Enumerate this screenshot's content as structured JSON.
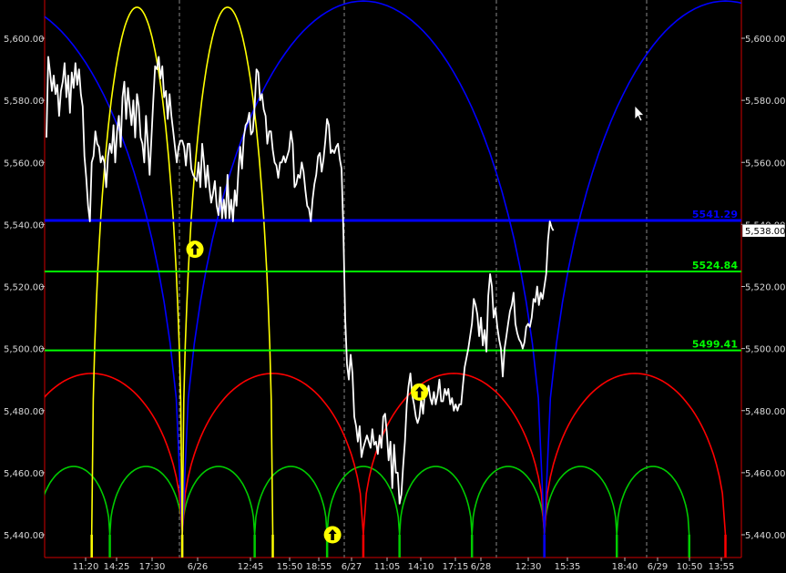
{
  "chart_data": {
    "type": "line",
    "title": "",
    "xlabel": "",
    "ylabel": "",
    "ylim": [
      5430,
      5612
    ],
    "y_ticks": [
      5440,
      5460,
      5480,
      5500,
      5520,
      5540,
      5560,
      5580,
      5600
    ],
    "y_tick_labels": [
      "5,440.00",
      "5,460.00",
      "5,480.00",
      "5,500.00",
      "5,520.00",
      "5,540.00",
      "5,560.00",
      "5,580.00",
      "5,600.00"
    ],
    "x_tick_labels": [
      "11:20",
      "14:25",
      "17:30",
      "6/26",
      "12:45",
      "15:50",
      "18:55",
      "6/27",
      "11:05",
      "14:10",
      "17:15",
      "6/28",
      "12:30",
      "15:35",
      "18:40",
      "6/29",
      "10:50",
      "13:55"
    ],
    "day_separators": [
      "6/26",
      "6/27",
      "6/28",
      "6/29"
    ],
    "grid": false,
    "last_price_label": "5,538.00",
    "last_price": 5538.0,
    "series": [
      {
        "role": "price",
        "color": "#ffffff",
        "index": [
          0,
          1,
          2,
          3,
          4,
          5,
          6,
          7,
          8,
          9,
          10,
          11,
          12,
          13,
          14,
          15,
          16,
          17,
          18,
          19,
          20,
          21,
          22,
          23,
          24,
          25,
          26,
          27,
          28,
          29,
          30,
          31,
          32,
          33,
          34,
          35,
          36,
          37,
          38,
          39,
          40,
          41,
          42,
          43,
          44,
          45,
          46,
          47,
          48,
          49,
          50,
          51,
          52,
          53,
          54,
          55,
          56,
          57,
          58,
          59,
          60,
          61,
          62,
          63,
          64,
          65,
          66,
          67,
          68,
          69,
          70,
          71,
          72,
          73,
          74,
          75,
          76,
          77,
          78,
          79,
          80,
          81,
          82,
          83,
          84,
          85,
          86,
          87,
          88,
          89,
          90,
          91,
          92,
          93,
          94,
          95,
          96,
          97,
          98,
          99,
          100,
          101,
          102,
          103,
          104,
          105,
          106,
          107,
          108,
          109,
          110,
          111,
          112,
          113,
          114,
          115,
          116,
          117,
          118,
          119,
          120,
          121,
          122,
          123,
          124,
          125,
          126,
          127,
          128,
          129,
          130,
          131,
          132,
          133,
          134,
          135,
          136,
          137,
          138,
          139,
          140,
          141,
          142,
          143,
          144,
          145,
          146,
          147,
          148,
          149,
          150,
          151,
          152,
          153,
          154,
          155,
          156,
          157,
          158,
          159,
          160,
          161,
          162,
          163,
          164,
          165,
          166,
          167,
          168,
          169,
          170,
          171,
          172,
          173,
          174,
          175,
          176,
          177,
          178,
          179,
          180,
          181,
          182,
          183,
          184,
          185,
          186,
          187,
          188,
          189,
          190,
          191,
          192,
          193,
          194,
          195,
          196,
          197,
          198,
          199,
          200,
          201,
          202,
          203,
          204,
          205,
          206,
          207,
          208,
          209,
          210,
          211,
          212,
          213,
          214,
          215,
          216,
          217,
          218,
          219,
          220,
          221,
          222,
          223,
          224,
          225,
          226,
          227,
          228,
          229,
          230,
          231,
          232,
          233,
          234,
          235,
          236,
          237,
          238,
          239,
          240,
          241,
          242,
          243,
          244,
          245,
          246,
          247,
          248,
          249,
          250,
          251,
          252,
          253,
          254,
          255,
          256,
          257,
          258,
          259,
          260,
          261,
          262,
          263,
          264,
          265,
          266,
          267,
          268,
          269,
          270,
          271,
          272,
          273,
          274,
          275,
          276,
          277,
          278,
          279,
          280,
          281,
          282,
          283,
          284,
          285,
          286,
          287,
          288,
          289,
          290,
          291,
          292,
          293,
          294,
          295,
          296,
          297,
          298,
          299,
          300,
          301,
          302,
          303,
          304,
          305,
          306,
          307,
          308,
          309,
          310,
          311,
          312,
          313,
          314,
          315,
          316,
          317,
          318,
          319,
          320,
          321,
          322,
          323,
          324,
          325,
          326,
          327,
          328,
          329,
          330,
          331,
          332,
          333,
          334
        ],
        "values": [
          5568,
          5594,
          5589,
          5583,
          5588,
          5582,
          5585,
          5575,
          5583,
          5586,
          5592,
          5581,
          5588,
          5576,
          5589,
          5584,
          5592,
          5585,
          5590,
          5582,
          5578,
          5562,
          5555,
          5546,
          5541,
          5560,
          5562,
          5570,
          5566,
          5565,
          5560,
          5562,
          5560,
          5552,
          5562,
          5566,
          5563,
          5572,
          5560,
          5570,
          5575,
          5565,
          5581,
          5586,
          5574,
          5584,
          5578,
          5572,
          5580,
          5568,
          5582,
          5578,
          5568,
          5566,
          5560,
          5575,
          5566,
          5556,
          5568,
          5580,
          5591,
          5590,
          5594,
          5587,
          5591,
          5581,
          5583,
          5574,
          5582,
          5575,
          5570,
          5565,
          5560,
          5565,
          5567,
          5567,
          5565,
          5559,
          5566,
          5566,
          5558,
          5556,
          5555,
          5554,
          5560,
          5552,
          5566,
          5560,
          5552,
          5559,
          5552,
          5547,
          5550,
          5554,
          5546,
          5543,
          5552,
          5542,
          5548,
          5542,
          5556,
          5542,
          5548,
          5541,
          5551,
          5546,
          5557,
          5565,
          5558,
          5568,
          5572,
          5573,
          5576,
          5569,
          5570,
          5578,
          5590,
          5589,
          5580,
          5582,
          5577,
          5575,
          5566,
          5570,
          5570,
          5564,
          5560,
          5559,
          5555,
          5560,
          5560,
          5562,
          5560,
          5562,
          5564,
          5570,
          5566,
          5552,
          5553,
          5556,
          5555,
          5560,
          5557,
          5551,
          5546,
          5545,
          5541,
          5548,
          5553,
          5556,
          5562,
          5563,
          5557,
          5561,
          5567,
          5574,
          5572,
          5563,
          5564,
          5563,
          5565,
          5566,
          5561,
          5558,
          5538,
          5510,
          5495,
          5490,
          5498,
          5492,
          5478,
          5475,
          5470,
          5475,
          5465,
          5468,
          5470,
          5472,
          5470,
          5468,
          5474,
          5469,
          5470,
          5466,
          5472,
          5468,
          5478,
          5479,
          5473,
          5464,
          5470,
          5455,
          5469,
          5460,
          5460,
          5450,
          5453,
          5462,
          5470,
          5482,
          5488,
          5492,
          5485,
          5482,
          5478,
          5476,
          5478,
          5484,
          5479,
          5486,
          5485,
          5488,
          5484,
          5482,
          5486,
          5482,
          5485,
          5490,
          5483,
          5483,
          5487,
          5485,
          5487,
          5482,
          5484,
          5480,
          5482,
          5480,
          5482,
          5482,
          5488,
          5494,
          5497,
          5500,
          5504,
          5508,
          5516,
          5514,
          5511,
          5504,
          5510,
          5501,
          5506,
          5499,
          5517,
          5524,
          5520,
          5510,
          5513,
          5507,
          5503,
          5500,
          5491,
          5500,
          5504,
          5508,
          5512,
          5514,
          5518,
          5508,
          5505,
          5503,
          5502,
          5500,
          5502,
          5507,
          5508,
          5507,
          5510,
          5516,
          5515,
          5520,
          5514,
          5518,
          5516,
          5520,
          5524,
          5535,
          5541,
          5539,
          5538
        ]
      },
      {
        "role": "horizontal-level",
        "name": "5541.29",
        "color": "#0000ff",
        "value": 5541.29
      },
      {
        "role": "horizontal-level",
        "name": "5524.84",
        "color": "#00ff00",
        "value": 5524.84
      },
      {
        "role": "horizontal-level",
        "name": "5499.41",
        "color": "#00ff00",
        "value": 5499.41
      },
      {
        "role": "cycle-arcs",
        "color": "#00cc00",
        "arc_top_value": 5462,
        "arc_base_value": 5440,
        "arc_roots_index": [
          -5,
          35,
          75,
          115,
          155,
          195,
          235,
          275,
          315,
          355
        ]
      },
      {
        "role": "cycle-arcs",
        "color": "#ff0000",
        "arc_top_value": 5492,
        "arc_base_value": 5440,
        "arc_roots_index": [
          -25,
          75,
          175,
          275,
          375
        ]
      },
      {
        "role": "cycle-arcs",
        "color": "#0000ff",
        "arc_top_value": 5612,
        "arc_base_value": 5440,
        "arc_roots_index": [
          -125,
          75,
          275,
          475
        ]
      },
      {
        "role": "cycle-arcs",
        "color": "#ffff00",
        "arc_top_value": 5610,
        "arc_base_value": 5440,
        "arc_roots_index": [
          25,
          75,
          125
        ]
      }
    ],
    "markers": [
      {
        "label": "up-arrow",
        "color": "#ffff00",
        "index": 82,
        "value": 5532
      },
      {
        "label": "up-arrow",
        "color": "#ffff00",
        "index": 158,
        "value": 5440
      },
      {
        "label": "up-arrow",
        "color": "#ffff00",
        "index": 206,
        "value": 5486
      }
    ],
    "colors": {
      "background": "#000000",
      "frame": "#d00000",
      "axis_text": "#d8d8d8",
      "last_box": "#ffffff"
    }
  }
}
